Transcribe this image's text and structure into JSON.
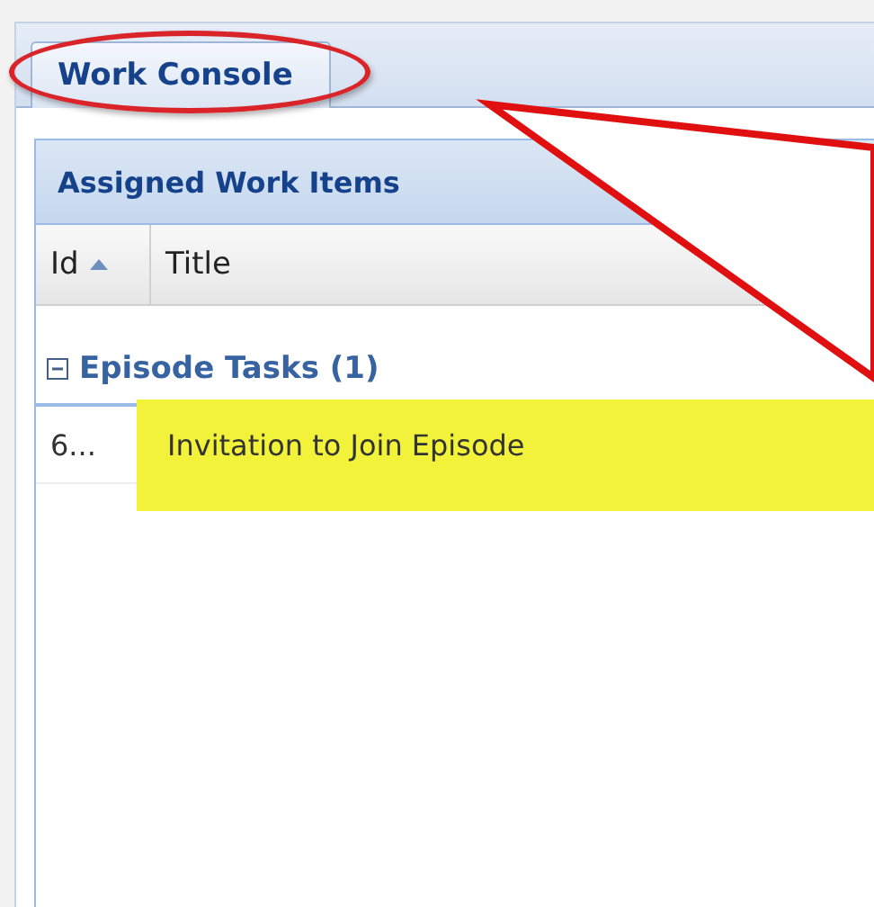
{
  "tabs": [
    {
      "label": "Work Console",
      "selected": true,
      "circled": true
    }
  ],
  "panel": {
    "title": "Assigned Work Items",
    "columns": [
      {
        "label": "Id",
        "sorted": true
      },
      {
        "label": "Title",
        "sorted": false
      }
    ],
    "groups": [
      {
        "label": "Episode Tasks (1)",
        "expanded": true,
        "rows": [
          {
            "id": "6...",
            "title": "Invitation to Join Episode",
            "highlighted": true
          }
        ]
      }
    ]
  }
}
